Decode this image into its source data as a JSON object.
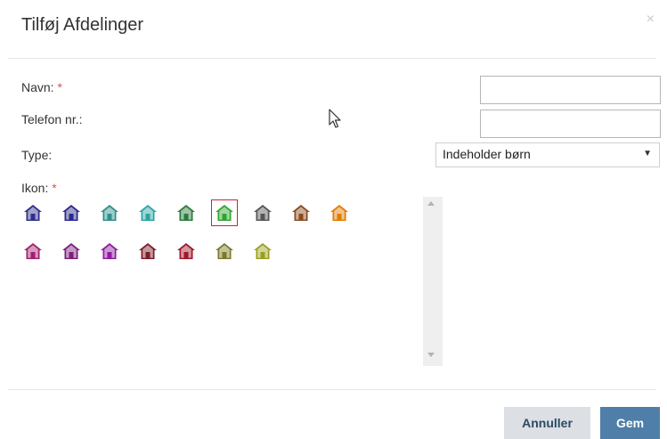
{
  "dialog": {
    "title": "Tilføj Afdelinger",
    "close_symbol": "×"
  },
  "form": {
    "name": {
      "label": "Navn:",
      "required_mark": "*",
      "value": ""
    },
    "phone": {
      "label": "Telefon nr.:",
      "value": ""
    },
    "type": {
      "label": "Type:",
      "selected": "Indeholder børn",
      "arrow": "▼"
    },
    "icon": {
      "label": "Ikon:",
      "required_mark": "*"
    }
  },
  "icons": {
    "icon_name": "house-icon",
    "selected_index": 5,
    "rows": [
      [
        "#2e2e8c",
        "#28288a",
        "#2e8f8a",
        "#2aa5a3",
        "#2b7a3c",
        "#2fa52f",
        "#555555",
        "#8a4a1e",
        "#e07b00"
      ],
      [
        "#a0206e",
        "#7a1f7a",
        "#8e1b9e",
        "#7a1e2a",
        "#a0162a",
        "#7a7a2a",
        "#9aa020"
      ]
    ]
  },
  "buttons": {
    "cancel": "Annuller",
    "save": "Gem"
  },
  "colors": {
    "required": "#d9534f",
    "primary_button": "#4f7fa8",
    "secondary_button": "#dcdfe3",
    "selected_icon_border": "#d0222b"
  }
}
